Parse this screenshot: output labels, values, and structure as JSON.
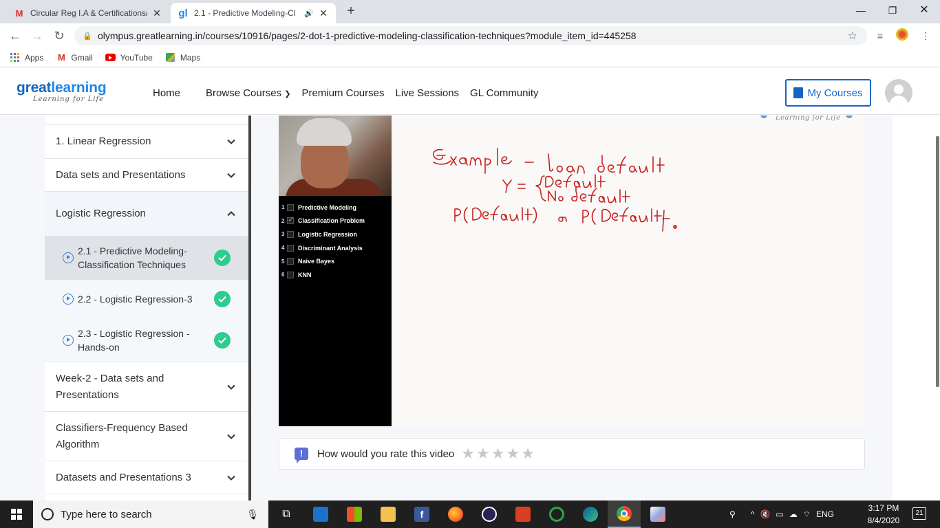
{
  "browser": {
    "tabs": [
      {
        "title": "Circular Reg I.A & Certifications/",
        "favicon": "gmail-icon"
      },
      {
        "title": "2.1 - Predictive Modeling-Cl",
        "favicon": "greatlearning-icon",
        "audio": true
      }
    ],
    "url": "olympus.greatlearning.in/courses/10916/pages/2-dot-1-predictive-modeling-classification-techniques?module_item_id=445258",
    "bookmarks": [
      {
        "label": "Apps",
        "icon": "apps-grid-icon"
      },
      {
        "label": "Gmail",
        "icon": "gmail-icon"
      },
      {
        "label": "YouTube",
        "icon": "youtube-icon"
      },
      {
        "label": "Maps",
        "icon": "maps-icon"
      }
    ]
  },
  "site": {
    "logo_main_a": "great",
    "logo_main_b": "learning",
    "logo_tagline": "Learning for Life",
    "nav": [
      "Home",
      "Browse Courses",
      "Premium Courses",
      "Live Sessions",
      "GL Community"
    ],
    "my_courses": "My Courses"
  },
  "sidebar": {
    "sections": [
      {
        "label": "1. Linear Regression",
        "expanded": false
      },
      {
        "label": "Data sets and Presentations",
        "expanded": false
      },
      {
        "label": "Logistic Regression",
        "expanded": true
      },
      {
        "label": "Week-2 - Data sets and Presentations",
        "expanded": false
      },
      {
        "label": "Classifiers-Frequency Based Algorithm",
        "expanded": false
      },
      {
        "label": "Datasets and Presentations 3",
        "expanded": false
      }
    ],
    "lessons": [
      {
        "label": "2.1 - Predictive Modeling-Classification Techniques",
        "done": true,
        "current": true
      },
      {
        "label": "2.2 - Logistic Regression-3",
        "done": true,
        "current": false
      },
      {
        "label": "2.3 - Logistic Regression - Hands-on",
        "done": true,
        "current": false
      }
    ]
  },
  "video": {
    "toc": [
      {
        "num": "1",
        "label": "Predictive Modeling",
        "checked": false
      },
      {
        "num": "2",
        "label": "Classification Problem",
        "checked": true
      },
      {
        "num": "3",
        "label": "Logistic Regression",
        "checked": false
      },
      {
        "num": "4",
        "label": "Discriminant Analysis",
        "checked": false
      },
      {
        "num": "5",
        "label": "Naive Bayes",
        "checked": false
      },
      {
        "num": "6",
        "label": "KNN",
        "checked": false
      }
    ],
    "watermark": "Learning for Life",
    "ink_color": "#c8211e"
  },
  "rating": {
    "prompt": "How would you rate this video",
    "stars": 5,
    "selected": 0
  },
  "taskbar": {
    "search_placeholder": "Type here to search",
    "language": "ENG",
    "time": "3:17 PM",
    "date": "8/4/2020",
    "notifications": "21"
  }
}
